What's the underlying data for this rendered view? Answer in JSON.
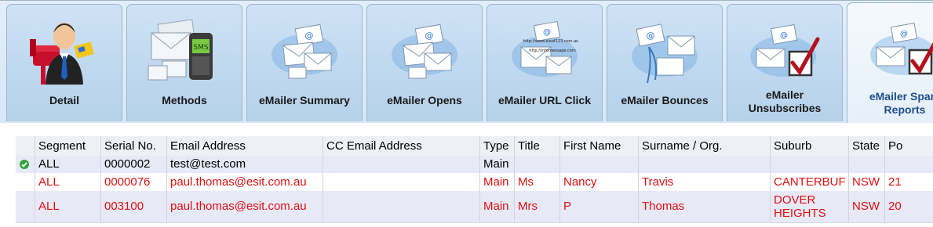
{
  "tabs": [
    {
      "label": "Detail",
      "icon": "person-mailbox-icon"
    },
    {
      "label": "Methods",
      "icon": "envelopes-sms-phone-icon"
    },
    {
      "label": "eMailer Summary",
      "icon": "email-envelopes-icon"
    },
    {
      "label": "eMailer Opens",
      "icon": "email-envelopes-icon"
    },
    {
      "label": "eMailer URL Click",
      "icon": "email-url-links-icon",
      "links": [
        "http://www.eleaf123.com.au",
        "http://infomessage.com"
      ]
    },
    {
      "label": "eMailer Bounces",
      "icon": "email-bounce-icon"
    },
    {
      "label": "eMailer Unsubscribes",
      "icon": "email-checkbox-icon"
    },
    {
      "label": "eMailer Spam Reports",
      "icon": "email-checkbox-icon"
    }
  ],
  "grid": {
    "columns": [
      "Segment",
      "Serial No.",
      "Email Address",
      "CC Email Address",
      "Type",
      "Title",
      "First Name",
      "Surname / Org.",
      "Suburb",
      "State",
      "Po"
    ],
    "rows": [
      {
        "segment": "ALL",
        "serial": "0000002",
        "email": "test@test.com",
        "cc": "",
        "type": "Main",
        "title": "",
        "first": "",
        "surname": "",
        "suburb": "",
        "state": "",
        "postcode": "",
        "status_icon": "check-icon"
      },
      {
        "segment": "ALL",
        "serial": "0000076",
        "email": "paul.thomas@esit.com.au",
        "cc": "",
        "type": "Main",
        "title": "Ms",
        "first": "Nancy",
        "surname": "Travis",
        "suburb": "CANTERBUF",
        "state": "NSW",
        "postcode": "21"
      },
      {
        "segment": "ALL",
        "serial": "003100",
        "email": "paul.thomas@esit.com.au",
        "cc": "",
        "type": "Main",
        "title": "Mrs",
        "first": "P",
        "surname": "Thomas",
        "suburb": "DOVER HEIGHTS",
        "state": "NSW",
        "postcode": "20"
      }
    ]
  },
  "colors": {
    "accent": "#1f4d8f",
    "error_row_text": "#e01010",
    "tab_bg": "#c2daf0"
  }
}
